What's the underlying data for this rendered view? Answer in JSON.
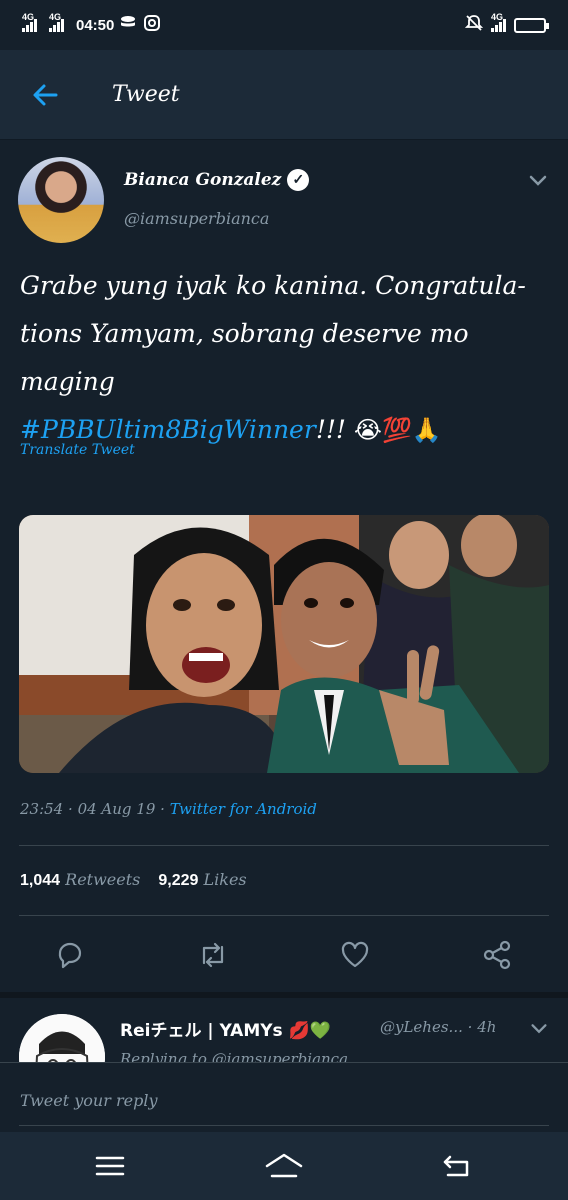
{
  "status_bar": {
    "network1": "4G",
    "network2": "4G",
    "time": "04:50",
    "network3": "4G"
  },
  "header": {
    "title": "Tweet"
  },
  "tweet": {
    "author_name": "Bianca Gonzalez",
    "author_handle": "@iamsuperbianca",
    "text_line1": "Grabe yung iyak ko kanina. Congratula-",
    "text_line2": "tions Yamyam, sobrang deserve mo maging",
    "hashtag": "#PBBUltim8BigWinner",
    "text_after_hashtag": "!!! ",
    "emojis": "😭💯🙏",
    "translate_label": "Translate Tweet",
    "time": "23:54",
    "date": "04 Aug 19",
    "source": "Twitter for Android",
    "retweets_count": "1,044",
    "retweets_label": "Retweets",
    "likes_count": "9,229",
    "likes_label": "Likes"
  },
  "reply": {
    "name": "Reiチェル | YAMYs 💋💚",
    "handle": "@yLehes...",
    "age": "4h",
    "sub": "Replying to @iamsuperbianca"
  },
  "composer": {
    "placeholder": "Tweet your reply"
  },
  "colors": {
    "accent": "#1da1f2",
    "background": "#15202b",
    "muted": "#8899a6"
  }
}
